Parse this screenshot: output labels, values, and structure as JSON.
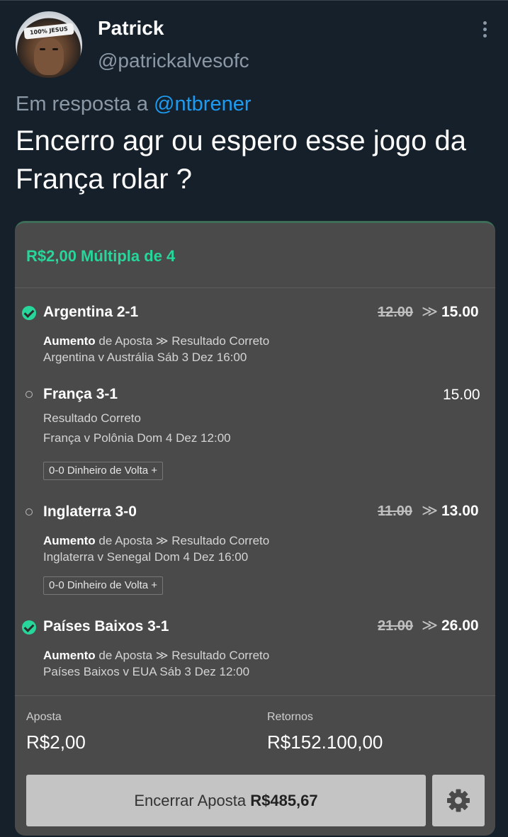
{
  "tweet": {
    "author_name": "Patrick",
    "author_handle": "@patrickalvesofc",
    "avatar_headband_text": "100% JESUS",
    "reply_prefix": "Em resposta a",
    "reply_mention": "@ntbrener",
    "text": "Encerro agr ou espero esse jogo da França rolar ?"
  },
  "bet": {
    "title": "R$2,00 Múltipla de 4",
    "selections": [
      {
        "status": "won",
        "name": "Argentina 2-1",
        "old_odds": "12.00",
        "arrow": "≫",
        "odds": "15.00",
        "market_prefix": "Aumento",
        "market_rest": "de Aposta ≫ Resultado Correto",
        "event": "Argentina v Austrália",
        "datetime": "Sáb 3 Dez 16:00"
      },
      {
        "status": "open",
        "name": "França 3-1",
        "odds": "15.00",
        "market": "Resultado Correto",
        "event": "França v Polônia",
        "datetime": "Dom 4 Dez 12:00",
        "cashback": "0-0 Dinheiro de Volta +"
      },
      {
        "status": "open",
        "name": "Inglaterra 3-0",
        "old_odds": "11.00",
        "arrow": "≫",
        "odds": "13.00",
        "market_prefix": "Aumento",
        "market_rest": "de Aposta ≫ Resultado Correto",
        "event": "Inglaterra v Senegal",
        "datetime": "Dom 4 Dez 16:00",
        "cashback": "0-0 Dinheiro de Volta +"
      },
      {
        "status": "won",
        "name": "Países Baixos 3-1",
        "old_odds": "21.00",
        "arrow": "≫",
        "odds": "26.00",
        "market_prefix": "Aumento",
        "market_rest": "de Aposta ≫ Resultado Correto",
        "event": "Países Baixos v EUA",
        "datetime": "Sáb 3 Dez 12:00"
      }
    ],
    "stake_label": "Aposta",
    "stake_value": "R$2,00",
    "returns_label": "Retornos",
    "returns_value": "R$152.100,00",
    "cashout_label": "Encerrar Aposta",
    "cashout_value": "R$485,67"
  },
  "colors": {
    "background": "#15202b",
    "accent_green": "#27d69b",
    "mention_blue": "#1d9bf0",
    "muted_text": "#8b98a5",
    "card": "#4a4a4a"
  },
  "icons": {
    "more": "vertical-ellipsis",
    "won": "check-circle",
    "open": "empty-circle",
    "settings": "gear"
  }
}
